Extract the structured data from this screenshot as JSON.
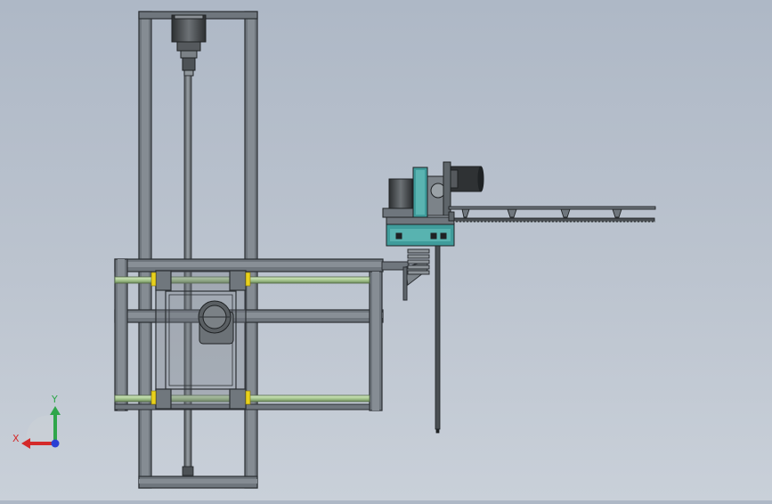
{
  "viewport": {
    "background_top": "#aeb8c6",
    "background_bottom": "#c9d0d9"
  },
  "colors": {
    "frame_fill": "#6f767d",
    "frame_stroke": "#2b2f33",
    "rail_green": "#b9d6a3",
    "bracket_yellow": "#e9d11c",
    "teal_accent": "#3f9c9b",
    "motor_dark": "#3a3d40",
    "axis_x": "#d42a2a",
    "axis_y": "#2fa64a",
    "axis_z": "#2a3fd4"
  },
  "triad": {
    "x_label": "X",
    "y_label": "Y",
    "x_icon": "x-axis-arrow-icon",
    "y_icon": "y-axis-arrow-icon",
    "z_icon": "z-axis-dot-icon"
  }
}
